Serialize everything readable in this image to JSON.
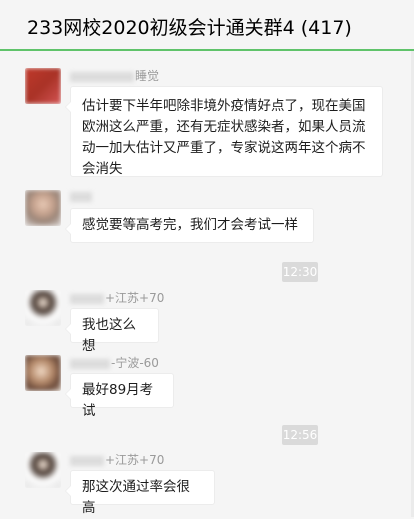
{
  "window": {
    "title": "233网校2020初级会计通关群4 (417)",
    "accent_color": "#5fc36a"
  },
  "messages": [
    {
      "sender": "睡觉",
      "sender_masked": true,
      "text": "估计要下半年吧除非境外疫情好点了，现在美国欧洲这么严重，还有无症状感染者，如果人员流动一加大估计又严重了，专家说这两年这个病不会消失",
      "avatar": "red-avatar"
    },
    {
      "sender": "",
      "sender_masked": true,
      "text": "感觉要等高考完，我们才会考试一样",
      "avatar": "girl-avatar"
    },
    {
      "timestamp": "12:30"
    },
    {
      "sender": "+江苏+70",
      "sender_masked": true,
      "text": "我也这么想",
      "avatar": "cartoon-avatar"
    },
    {
      "sender": "-宁波-60",
      "sender_masked": true,
      "text": "最好89月考试",
      "avatar": "photo-avatar"
    },
    {
      "timestamp": "12:56"
    },
    {
      "sender": "+江苏+70",
      "sender_masked": true,
      "text": "那这次通过率会很高",
      "avatar": "cartoon-avatar"
    }
  ]
}
